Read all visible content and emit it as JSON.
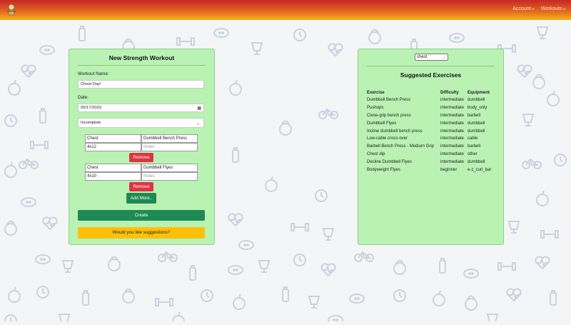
{
  "navbar": {
    "account_label": "Account",
    "workouts_label": "Workouts",
    "colors": {
      "top": "#c62828",
      "mid": "#e2661e",
      "bottom": "#f3b319"
    }
  },
  "form": {
    "title": "New Strength Workout",
    "name_label": "Workout Name:",
    "name_value": "Chest Day!",
    "date_label": "Date:",
    "date_value": "05/17/2023",
    "status_value": "Incomplete",
    "exercises": [
      {
        "muscle": "Chest",
        "exercise": "Dumbbell Bench Press",
        "sets": "4x12",
        "notes_placeholder": "Notes"
      },
      {
        "muscle": "Chest",
        "exercise": "Dumbbell Flyes",
        "sets": "4x10",
        "notes_placeholder": "Notes"
      }
    ],
    "remove_label": "Remove",
    "add_more_label": "Add More..",
    "create_label": "Create",
    "suggestions_label": "Would you like suggestions?"
  },
  "suggestions": {
    "filter_value": "chest",
    "title": "Suggested Exercises",
    "headers": [
      "Exercise",
      "Difficulty",
      "Equipment"
    ],
    "rows": [
      [
        "Dumbbell Bench Press",
        "intermediate",
        "dumbbell"
      ],
      [
        "Pushups",
        "intermediate",
        "body_only"
      ],
      [
        "Close-grip bench press",
        "intermediate",
        "barbell"
      ],
      [
        "Dumbbell Flyes",
        "intermediate",
        "dumbbell"
      ],
      [
        "Incline dumbbell bench press",
        "intermediate",
        "dumbbell"
      ],
      [
        "Low-cable cross-over",
        "intermediate",
        "cable"
      ],
      [
        "Barbell Bench Press - Medium Grip",
        "intermediate",
        "barbell"
      ],
      [
        "Chest dip",
        "intermediate",
        "other"
      ],
      [
        "Decline Dumbbell Flyes",
        "intermediate",
        "dumbbell"
      ],
      [
        "Bodyweight Flyes",
        "beginner",
        "e-z_curl_bar"
      ]
    ]
  },
  "colors": {
    "card_bg": "#b9f2b3",
    "remove": "#dc3545",
    "create": "#1e8a56",
    "suggest": "#ffc107",
    "pattern": "#c9d3df"
  }
}
